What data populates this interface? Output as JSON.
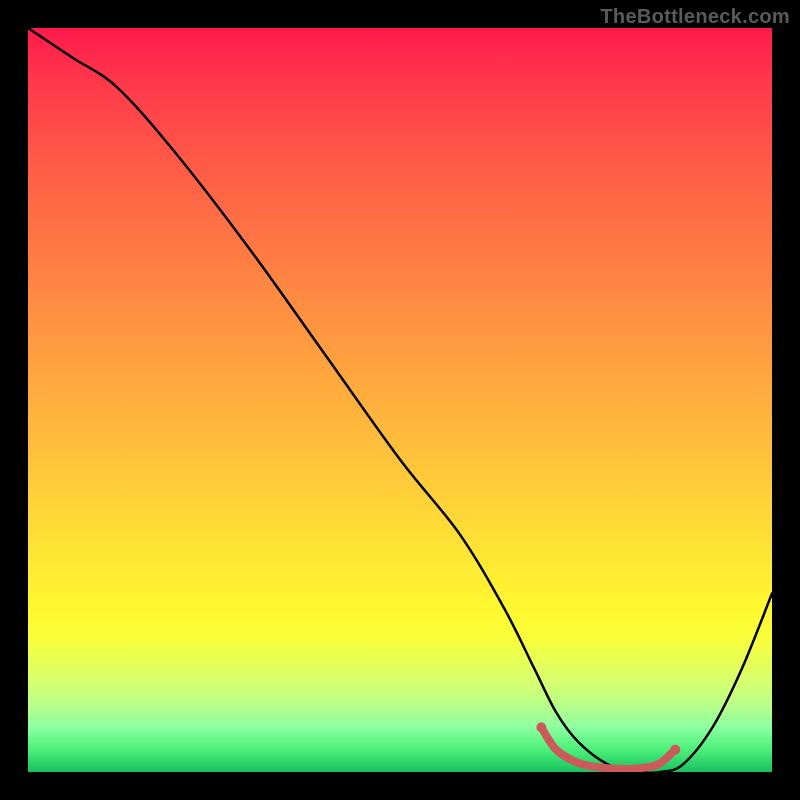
{
  "watermark": "TheBottleneck.com",
  "chart_data": {
    "type": "line",
    "title": "",
    "xlabel": "",
    "ylabel": "",
    "xlim": [
      0,
      100
    ],
    "ylim": [
      0,
      100
    ],
    "grid": false,
    "series": [
      {
        "name": "curve",
        "color": "#000000",
        "x": [
          0,
          6,
          12,
          20,
          30,
          40,
          50,
          58,
          64,
          68,
          71,
          74,
          78,
          82,
          85,
          88,
          92,
          96,
          100
        ],
        "values": [
          100,
          96,
          92,
          83,
          70,
          56,
          42,
          32,
          22,
          14,
          8,
          4,
          1,
          0,
          0,
          1,
          6,
          14,
          24
        ]
      },
      {
        "name": "valley-highlight",
        "color": "#d46a6a",
        "x": [
          69,
          71,
          74,
          77,
          80,
          83,
          85,
          87
        ],
        "values": [
          6,
          3,
          1.2,
          0.6,
          0.4,
          0.6,
          1.2,
          3
        ]
      }
    ],
    "background_gradient": {
      "top": "#ff1a4d",
      "mid": "#ffe934",
      "bottom": "#18c060"
    }
  }
}
